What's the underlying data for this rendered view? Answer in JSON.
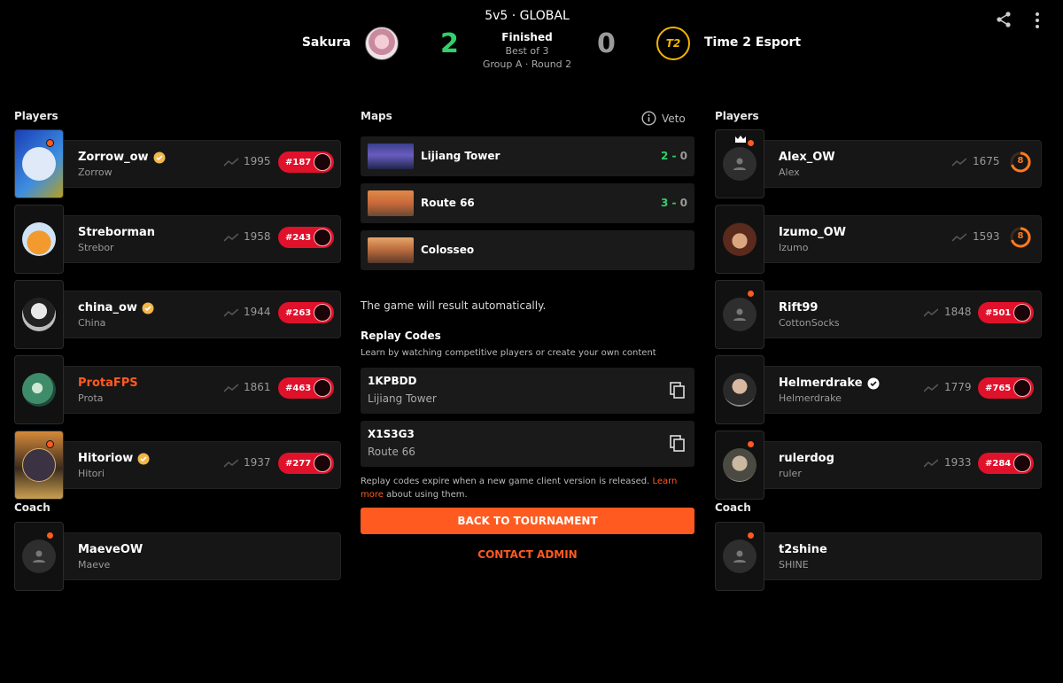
{
  "header": {
    "mode": "5v5 · GLOBAL",
    "status": "Finished",
    "best_of": "Best of 3",
    "group_round": "Group A · Round 2",
    "team_left": {
      "name": "Sakura",
      "score": "2",
      "score_color": "#2fd16a"
    },
    "team_right": {
      "name": "Time 2 Esport",
      "score": "0",
      "logo_text": "T2",
      "score_color": "#9a9a9a"
    },
    "icons": [
      "share-icon",
      "more-vertical-icon"
    ]
  },
  "left": {
    "players_title": "Players",
    "coach_title": "Coach",
    "players": [
      {
        "name": "Zorrow_ow",
        "sub": "Zorrow",
        "verified": true,
        "rating": "1995",
        "rank": "#187"
      },
      {
        "name": "Streborman",
        "sub": "Strebor",
        "verified": false,
        "rating": "1958",
        "rank": "#243"
      },
      {
        "name": "china_ow",
        "sub": "China",
        "verified": true,
        "rating": "1944",
        "rank": "#263"
      },
      {
        "name": "ProtaFPS",
        "sub": "Prota",
        "verified": false,
        "rating": "1861",
        "rank": "#463"
      },
      {
        "name": "Hitoriow",
        "sub": "Hitori",
        "verified": true,
        "rating": "1937",
        "rank": "#277"
      }
    ],
    "coach": {
      "name": "MaeveOW",
      "sub": "Maeve"
    }
  },
  "right": {
    "players_title": "Players",
    "coach_title": "Coach",
    "players": [
      {
        "name": "Alex_OW",
        "sub": "Alex",
        "rating": "1675",
        "level": "8"
      },
      {
        "name": "Izumo_OW",
        "sub": "Izumo",
        "rating": "1593",
        "level": "8"
      },
      {
        "name": "Rift99",
        "sub": "CottonSocks",
        "rating": "1848",
        "rank": "#501"
      },
      {
        "name": "Helmerdrake",
        "sub": "Helmerdrake",
        "verified": true,
        "rating": "1779",
        "rank": "#765"
      },
      {
        "name": "rulerdog",
        "sub": "ruler",
        "rating": "1933",
        "rank": "#284"
      }
    ],
    "coach": {
      "name": "t2shine",
      "sub": "SHINE"
    }
  },
  "maps": {
    "title": "Maps",
    "veto_label": "Veto",
    "items": [
      {
        "name": "Lijiang Tower",
        "score_left": "2",
        "dash": " - ",
        "score_right": "0"
      },
      {
        "name": "Route 66",
        "score_left": "3",
        "dash": " - ",
        "score_right": "0"
      },
      {
        "name": "Colosseo"
      }
    ]
  },
  "result_note": "The game will result automatically.",
  "replay": {
    "title": "Replay Codes",
    "subtitle": "Learn by watching competitive players or create your own content",
    "codes": [
      {
        "code": "1KPBDD",
        "map": "Lijiang Tower"
      },
      {
        "code": "X1S3G3",
        "map": "Route 66"
      }
    ],
    "expire_text": "Replay codes expire when a new game client version is released.",
    "learn_more": "Learn more",
    "expire_tail": "about using them."
  },
  "buttons": {
    "back": "BACK TO TOURNAMENT",
    "admin": "CONTACT ADMIN"
  },
  "colors": {
    "accent": "#ff5a1f",
    "rank_pill": "#e0112b",
    "win": "#2fd16a",
    "card": "#161616"
  }
}
